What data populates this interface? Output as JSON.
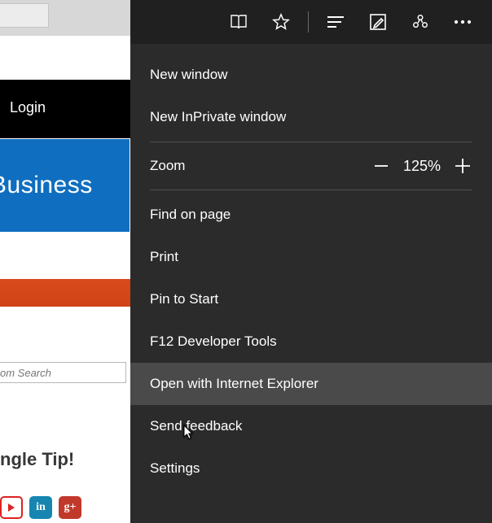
{
  "toolbar": {
    "reading_list_icon": "reading-list",
    "favorites_icon": "star",
    "hub_icon": "hub",
    "notes_icon": "web-note",
    "share_icon": "share",
    "more_icon": "more"
  },
  "page": {
    "login_label": "Login",
    "blue_banner_text": "Business",
    "search_placeholder": "om Search",
    "tip_text": "ngle Tip!",
    "social": {
      "youtube": "YouTube",
      "linkedin": "in",
      "googleplus": "g+"
    }
  },
  "menu": {
    "new_window": "New window",
    "new_inprivate": "New InPrivate window",
    "zoom_label": "Zoom",
    "zoom_value": "125%",
    "find": "Find on page",
    "print": "Print",
    "pin": "Pin to Start",
    "devtools": "F12 Developer Tools",
    "open_ie": "Open with Internet Explorer",
    "feedback": "Send feedback",
    "settings": "Settings"
  }
}
